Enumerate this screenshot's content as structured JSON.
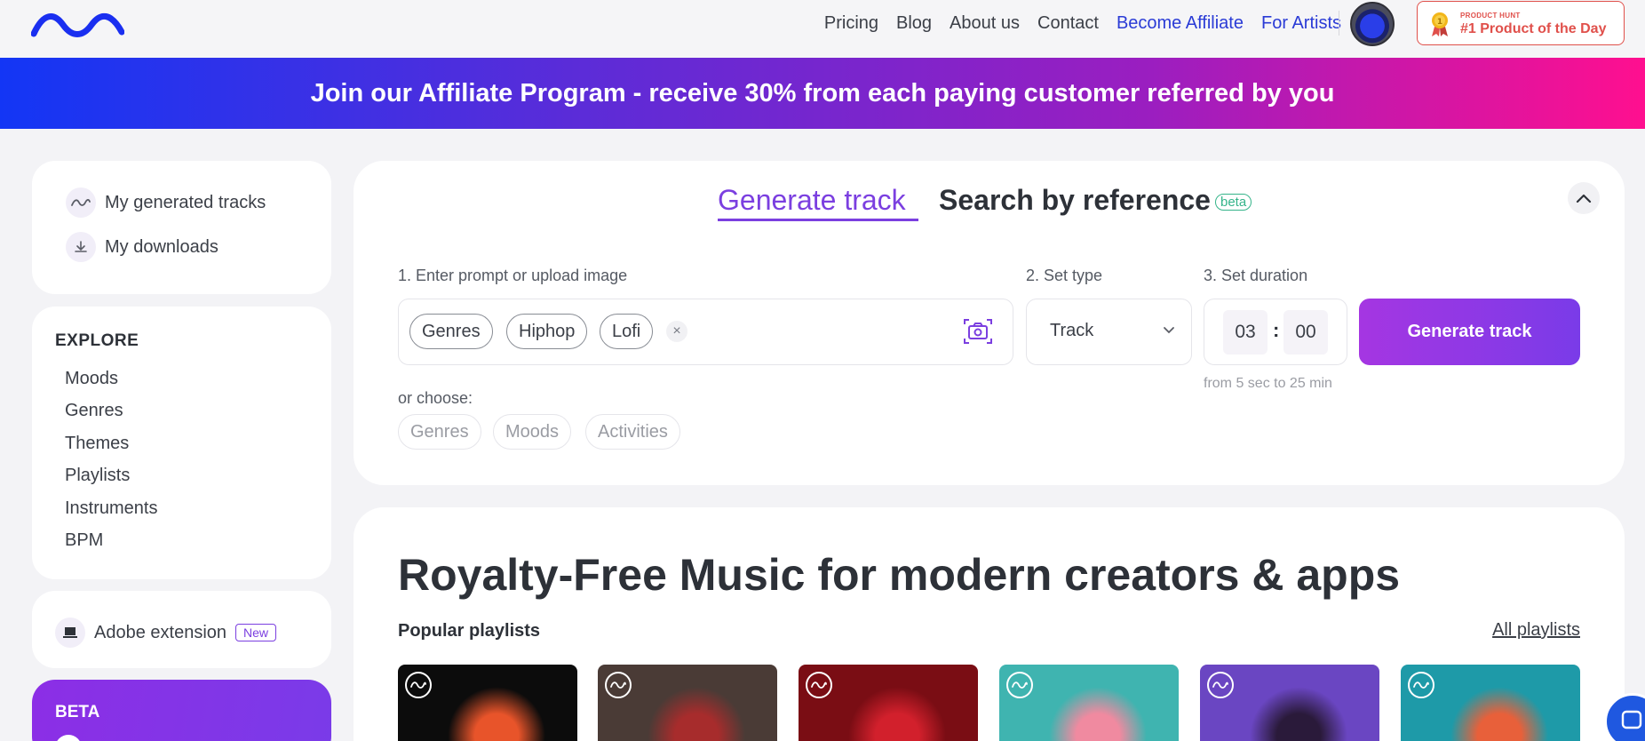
{
  "header": {
    "logo_icon": "wave-logo-icon",
    "nav": [
      {
        "label": "Pricing",
        "accent": false
      },
      {
        "label": "Blog",
        "accent": false
      },
      {
        "label": "About us",
        "accent": false
      },
      {
        "label": "Contact",
        "accent": false
      },
      {
        "label": "Become Affiliate",
        "accent": true
      },
      {
        "label": "For Artists",
        "accent": true
      }
    ],
    "product_hunt": {
      "small": "PRODUCT HUNT",
      "big": "#1 Product of the Day"
    }
  },
  "banner": {
    "text": "Join our Affiliate Program - receive 30% from each paying customer referred by you"
  },
  "sidebar": {
    "user_items": [
      {
        "label": "My generated tracks",
        "icon": "wave-icon"
      },
      {
        "label": "My downloads",
        "icon": "download-icon"
      }
    ],
    "explore_title": "EXPLORE",
    "explore_items": [
      "Moods",
      "Genres",
      "Themes",
      "Playlists",
      "Instruments",
      "BPM"
    ],
    "adobe": {
      "label": "Adobe extension",
      "badge": "New"
    },
    "beta": {
      "label": "BETA"
    }
  },
  "generator": {
    "tabs": {
      "generate": "Generate track",
      "reference": "Search by reference",
      "reference_badge": "beta"
    },
    "step1_label": "1. Enter prompt or upload image",
    "step2_label": "2. Set type",
    "step3_label": "3. Set duration",
    "chips": [
      "Genres",
      "Hiphop",
      "Lofi"
    ],
    "clear_symbol": "×",
    "type_value": "Track",
    "duration": {
      "minutes": "03",
      "seconds": "00",
      "separator": ":",
      "hint": "from 5 sec to 25 min"
    },
    "button": "Generate track",
    "choose_label": "or choose:",
    "choose_chips": [
      "Genres",
      "Moods",
      "Activities"
    ]
  },
  "content": {
    "title": "Royalty-Free Music for modern creators & apps",
    "popular_label": "Popular playlists",
    "all_link": "All playlists",
    "thumbnails": [
      {
        "bg": "#0c0c0c",
        "accent": "#e8542a"
      },
      {
        "bg": "#4a3b36",
        "accent": "#a72c2c"
      },
      {
        "bg": "#7a0d14",
        "accent": "#d2202c"
      },
      {
        "bg": "#3fb4b0",
        "accent": "#f08aa0"
      },
      {
        "bg": "#6a46c2",
        "accent": "#2a1a3a"
      },
      {
        "bg": "#1e9aa8",
        "accent": "#e8603a"
      }
    ]
  },
  "colors": {
    "accent": "#7b3fe0",
    "link": "#2a3bd6",
    "ph_red": "#e0504b"
  }
}
